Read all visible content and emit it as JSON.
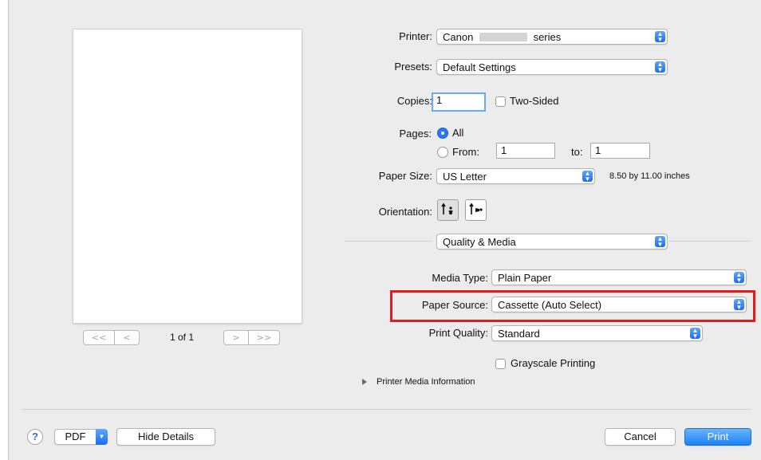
{
  "preview": {
    "page_indicator": "1 of 1",
    "nav_first": "<<",
    "nav_prev": "<",
    "nav_next": ">",
    "nav_last": ">>"
  },
  "settings": {
    "printer": {
      "label": "Printer:",
      "value_prefix": "Canon",
      "value_suffix": "series"
    },
    "presets": {
      "label": "Presets:",
      "value": "Default Settings"
    },
    "copies": {
      "label": "Copies:",
      "value": "1"
    },
    "two_sided": {
      "label": "Two-Sided",
      "checked": false
    },
    "pages": {
      "label": "Pages:",
      "all_label": "All",
      "from_label": "From:",
      "from_value": "1",
      "to_label": "to:",
      "to_value": "1",
      "selected": "All"
    },
    "paper_size": {
      "label": "Paper Size:",
      "value": "US Letter",
      "dimensions": "8.50 by 11.00 inches"
    },
    "orientation": {
      "label": "Orientation:",
      "selected": "portrait"
    },
    "section": {
      "value": "Quality & Media"
    },
    "media_type": {
      "label": "Media Type:",
      "value": "Plain Paper"
    },
    "paper_source": {
      "label": "Paper Source:",
      "value": "Cassette (Auto Select)"
    },
    "print_quality": {
      "label": "Print Quality:",
      "value": "Standard"
    },
    "grayscale": {
      "label": "Grayscale Printing",
      "checked": false
    },
    "printer_media_info": {
      "label": "Printer Media Information"
    }
  },
  "footer": {
    "help": "?",
    "pdf": "PDF",
    "hide_details": "Hide Details",
    "cancel": "Cancel",
    "print": "Print"
  },
  "colors": {
    "highlight": "#e41b1b",
    "accent": "#2b7af2"
  }
}
